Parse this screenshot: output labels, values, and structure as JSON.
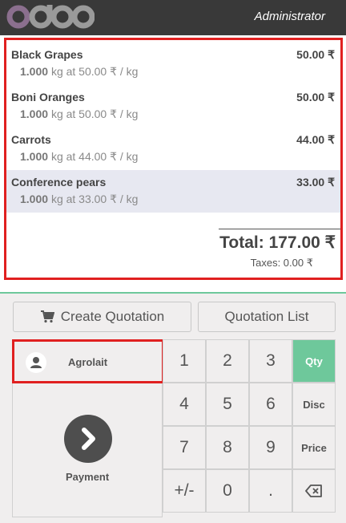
{
  "header": {
    "brand": "odoo",
    "user": "Administrator"
  },
  "orderlines": [
    {
      "name": "Black Grapes",
      "price": "50.00 ₹",
      "qty": "1.000",
      "info": "kg at 50.00 ₹ / kg"
    },
    {
      "name": "Boni Oranges",
      "price": "50.00 ₹",
      "qty": "1.000",
      "info": "kg at 50.00 ₹ / kg"
    },
    {
      "name": "Carrots",
      "price": "44.00 ₹",
      "qty": "1.000",
      "info": "kg at 44.00 ₹ / kg"
    },
    {
      "name": "Conference pears",
      "price": "33.00 ₹",
      "qty": "1.000",
      "info": "kg at 33.00 ₹ / kg"
    }
  ],
  "summary": {
    "total": "Total: 177.00 ₹",
    "taxes": "Taxes: 0.00 ₹"
  },
  "actions": {
    "create_quotation": "Create Quotation",
    "quotation_list": "Quotation List"
  },
  "customer": {
    "name": "Agrolait"
  },
  "payment": {
    "label": "Payment"
  },
  "numpad": {
    "k1": "1",
    "k2": "2",
    "k3": "3",
    "k4": "4",
    "k5": "5",
    "k6": "6",
    "k7": "7",
    "k8": "8",
    "k9": "9",
    "sign": "+/-",
    "k0": "0",
    "dot": ".",
    "qty": "Qty",
    "disc": "Disc",
    "price": "Price"
  },
  "colors": {
    "accent": "#6ec89b",
    "highlight": "#e02020",
    "header": "#393939"
  }
}
